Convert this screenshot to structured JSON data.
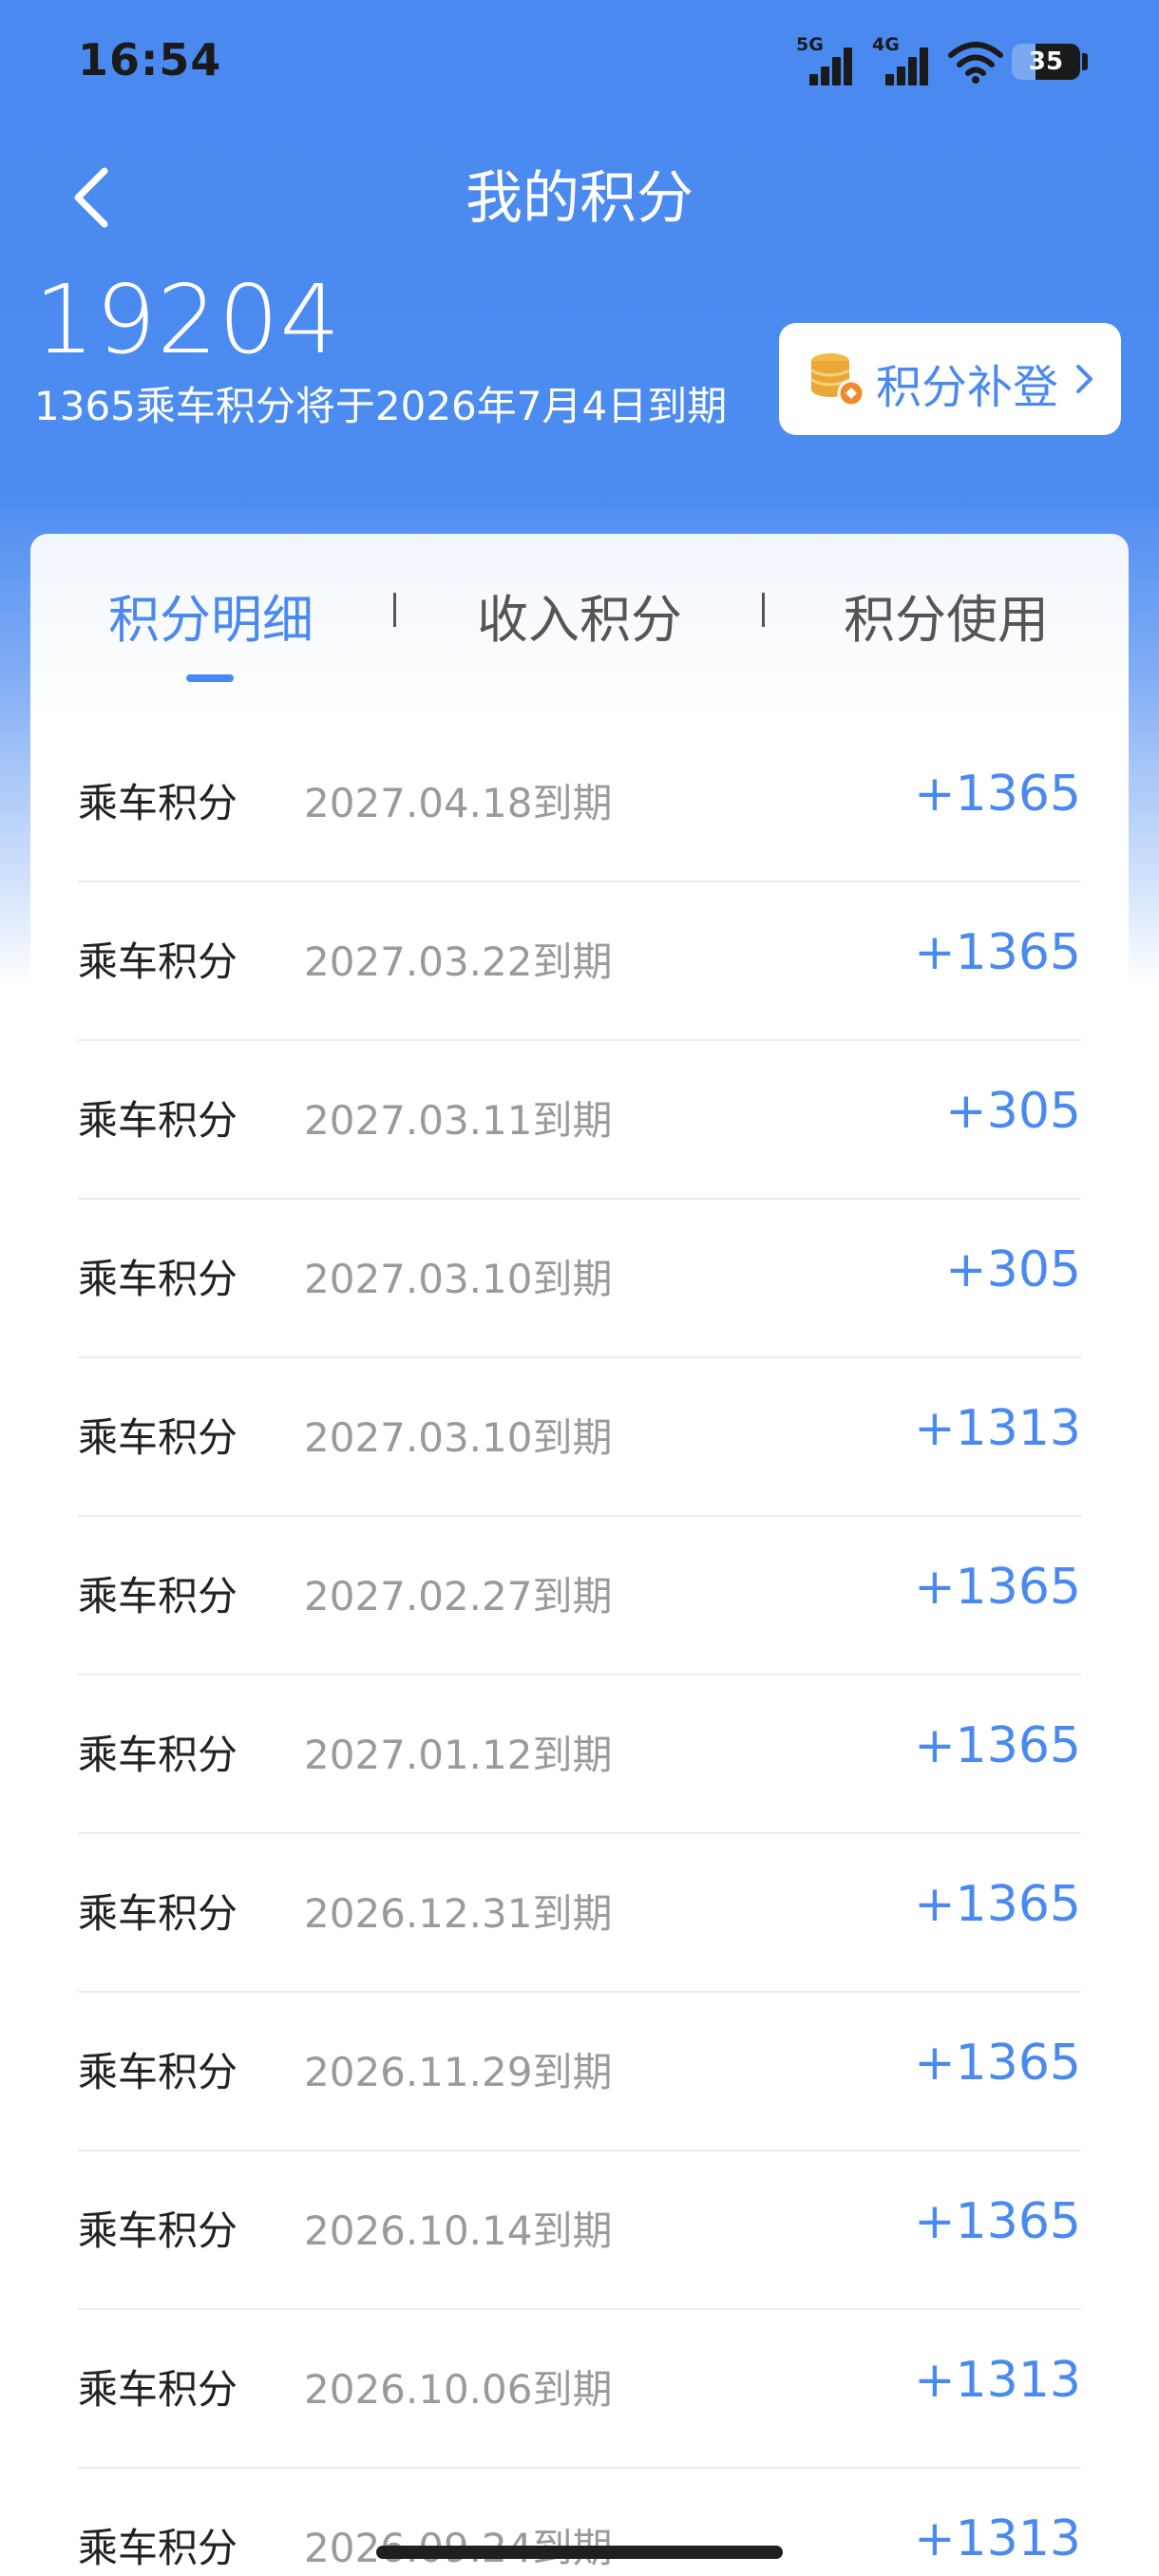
{
  "status_bar": {
    "time": "16:54",
    "network_1": "5G",
    "network_2": "4G",
    "battery": "35",
    "battery_level_percent": 35
  },
  "header": {
    "title": "我的积分",
    "back_icon": "chevron-left-icon"
  },
  "summary": {
    "balance": "19204",
    "expire_note": "1365乘车积分将于2026年7月4日到期",
    "supplement_label": "积分补登",
    "supplement_icon": "coin-stack-icon"
  },
  "tabs": [
    {
      "label": "积分明细",
      "active": true
    },
    {
      "label": "收入积分",
      "active": false
    },
    {
      "label": "积分使用",
      "active": false
    }
  ],
  "records": [
    {
      "type": "乘车积分",
      "date": "2027.04.18到期",
      "amount": "+1365"
    },
    {
      "type": "乘车积分",
      "date": "2027.03.22到期",
      "amount": "+1365"
    },
    {
      "type": "乘车积分",
      "date": "2027.03.11到期",
      "amount": "+305"
    },
    {
      "type": "乘车积分",
      "date": "2027.03.10到期",
      "amount": "+305"
    },
    {
      "type": "乘车积分",
      "date": "2027.03.10到期",
      "amount": "+1313"
    },
    {
      "type": "乘车积分",
      "date": "2027.02.27到期",
      "amount": "+1365"
    },
    {
      "type": "乘车积分",
      "date": "2027.01.12到期",
      "amount": "+1365"
    },
    {
      "type": "乘车积分",
      "date": "2026.12.31到期",
      "amount": "+1365"
    },
    {
      "type": "乘车积分",
      "date": "2026.11.29到期",
      "amount": "+1365"
    },
    {
      "type": "乘车积分",
      "date": "2026.10.14到期",
      "amount": "+1365"
    },
    {
      "type": "乘车积分",
      "date": "2026.10.06到期",
      "amount": "+1313"
    },
    {
      "type": "乘车积分",
      "date": "2026.09.24到期",
      "amount": "+1313"
    }
  ],
  "colors": {
    "accent": "#4a8af0",
    "header_bg": "#4a8af0",
    "amount": "#4a8af0",
    "date_text": "#9a9a9a"
  }
}
